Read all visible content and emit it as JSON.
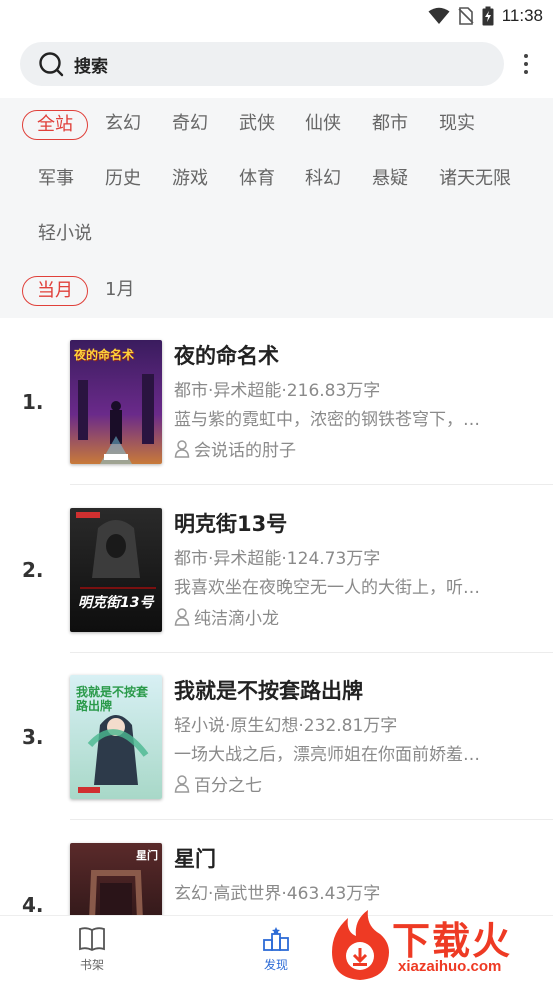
{
  "status_bar": {
    "time": "11:38"
  },
  "search": {
    "label": "搜索"
  },
  "categories": [
    "全站",
    "玄幻",
    "奇幻",
    "武侠",
    "仙侠",
    "都市",
    "现实",
    "军事",
    "历史",
    "游戏",
    "体育",
    "科幻",
    "悬疑",
    "诸天无限",
    "轻小说"
  ],
  "selected_category": "全站",
  "periods": {
    "selected": "当月",
    "other": "1月"
  },
  "books": [
    {
      "rank": "1.",
      "title": "夜的命名术",
      "meta": "都市·异术超能·216.83万字",
      "desc": "蓝与紫的霓虹中，浓密的钢铁苍穹下，…",
      "author": "会说话的肘子",
      "cover_text": "夜的命名术"
    },
    {
      "rank": "2.",
      "title": "明克街13号",
      "meta": "都市·异术超能·124.73万字",
      "desc": "我喜欢坐在夜晚空无一人的大街上，听…",
      "author": "纯洁滴小龙",
      "cover_text": "明克街13号"
    },
    {
      "rank": "3.",
      "title": "我就是不按套路出牌",
      "meta": "轻小说·原生幻想·232.81万字",
      "desc": "一场大战之后，漂亮师姐在你面前娇羞…",
      "author": "百分之七",
      "cover_text": "我就是不按套路出牌"
    },
    {
      "rank": "4.",
      "title": "星门",
      "meta": "玄幻·高武世界·463.43万字",
      "desc": "",
      "author": "",
      "cover_text": "星门"
    }
  ],
  "tabbar": {
    "bookshelf": "书架",
    "discover": "发现"
  },
  "watermark": {
    "text": "下载火",
    "sub": "xiazaihuo.com"
  },
  "colors": {
    "accent_red": "#e0403a",
    "tab_active": "#2d6bd6",
    "watermark": "#ee3a24"
  }
}
